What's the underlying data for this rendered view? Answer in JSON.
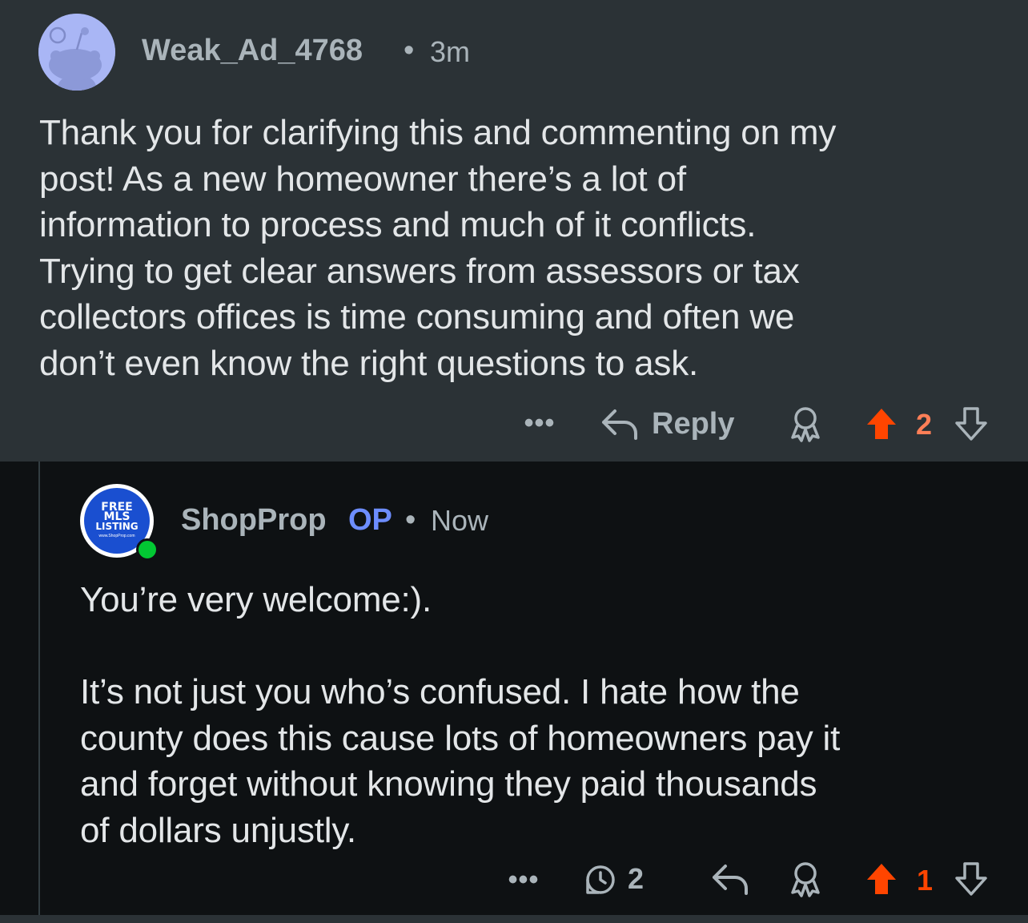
{
  "parent_comment": {
    "username": "Weak_Ad_4768",
    "separator": "•",
    "time": "3m",
    "body": "Thank you for clarifying this and commenting on my\npost! As a new homeowner there’s a lot of\ninformation to process and much of it conflicts.\nTrying to get clear answers from assessors or tax\ncollectors offices is time consuming and often we\ndon’t even know the right questions to ask.",
    "actions": {
      "more": "•••",
      "reply_label": "Reply",
      "vote_count": "2"
    }
  },
  "reply_comment": {
    "avatar": {
      "line1": "FREE",
      "line2": "MLS",
      "line3": "LISTING",
      "line4": "www.ShopProp.com"
    },
    "username": "ShopProp",
    "op_label": "OP",
    "separator": "•",
    "time": "Now",
    "body": "You’re very welcome:).\n\nIt’s not just you who’s confused. I hate how the\ncounty does this cause lots of homeowners pay it\nand forget without knowing they paid thousands\nof dollars unjustly.",
    "actions": {
      "more": "•••",
      "reply_count": "2",
      "vote_count": "1"
    }
  },
  "colors": {
    "upvote_active": "#ff4500",
    "upvote_count_parent": "#ff7f57",
    "op_blue": "#6d8dff",
    "online_green": "#02c833",
    "muted_text": "#aab4ba",
    "body_text": "#e3e6e8"
  },
  "icons": {
    "reply": "reply-arrow-icon",
    "award": "award-icon",
    "upvote": "upvote-arrow-icon",
    "downvote": "downvote-arrow-icon",
    "replies": "comment-count-icon"
  }
}
